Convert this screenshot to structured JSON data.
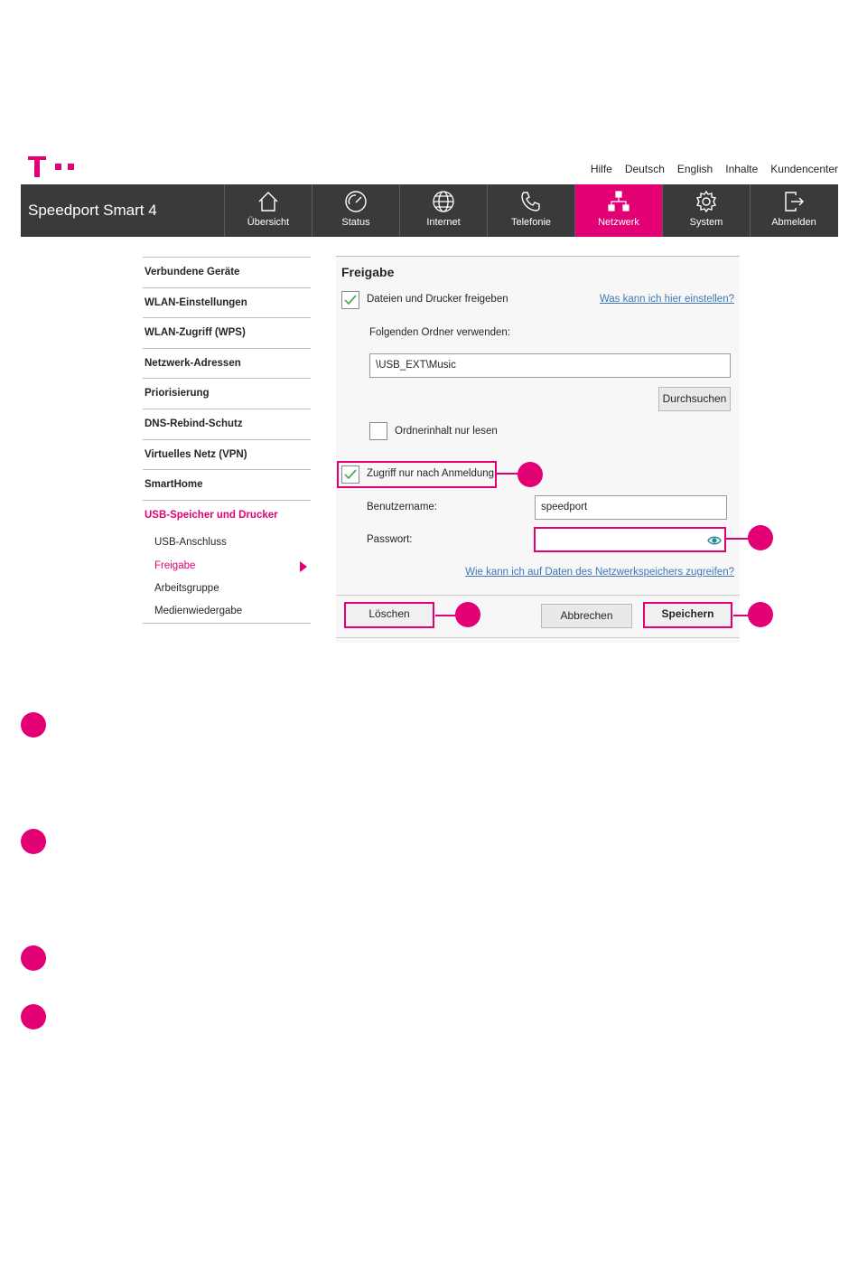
{
  "header": {
    "top_links": [
      "Hilfe",
      "Deutsch",
      "English",
      "Inhalte",
      "Kundencenter"
    ],
    "brand": "Speedport Smart 4"
  },
  "nav": [
    {
      "label": "Übersicht",
      "icon": "home-icon"
    },
    {
      "label": "Status",
      "icon": "gauge-icon"
    },
    {
      "label": "Internet",
      "icon": "globe-icon"
    },
    {
      "label": "Telefonie",
      "icon": "phone-icon"
    },
    {
      "label": "Netzwerk",
      "icon": "network-icon",
      "active": true
    },
    {
      "label": "System",
      "icon": "gear-icon"
    },
    {
      "label": "Abmelden",
      "icon": "logout-icon"
    }
  ],
  "sidebar": {
    "items": [
      "Verbundene Geräte",
      "WLAN-Einstellungen",
      "WLAN-Zugriff (WPS)",
      "Netzwerk-Adressen",
      "Priorisierung",
      "DNS-Rebind-Schutz",
      "Virtuelles Netz (VPN)",
      "SmartHome",
      "USB-Speicher und Drucker"
    ],
    "sub_items": [
      "USB-Anschluss",
      "Freigabe",
      "Arbeitsgruppe",
      "Medienwiedergabe"
    ]
  },
  "main": {
    "title": "Freigabe",
    "share_label": "Dateien und Drucker freigeben",
    "help_link": "Was kann ich hier einstellen?",
    "folder_label": "Folgenden Ordner verwenden:",
    "folder_value": "\\USB_EXT\\Music",
    "browse_label": "Durchsuchen",
    "readonly_label": "Ordnerinhalt nur lesen",
    "login_label": "Zugriff nur nach Anmeldung",
    "username_label": "Benutzername:",
    "username_value": "speedport",
    "password_label": "Passwort:",
    "password_value": "",
    "data_link": "Wie kann ich auf Daten des Netzwerkspeichers zugreifen?",
    "delete_label": "Löschen",
    "cancel_label": "Abbrechen",
    "save_label": "Speichern"
  },
  "colors": {
    "accent": "#e20074",
    "navbar": "#3a3a3a",
    "link": "#3f78b8",
    "check": "#4caf50"
  }
}
